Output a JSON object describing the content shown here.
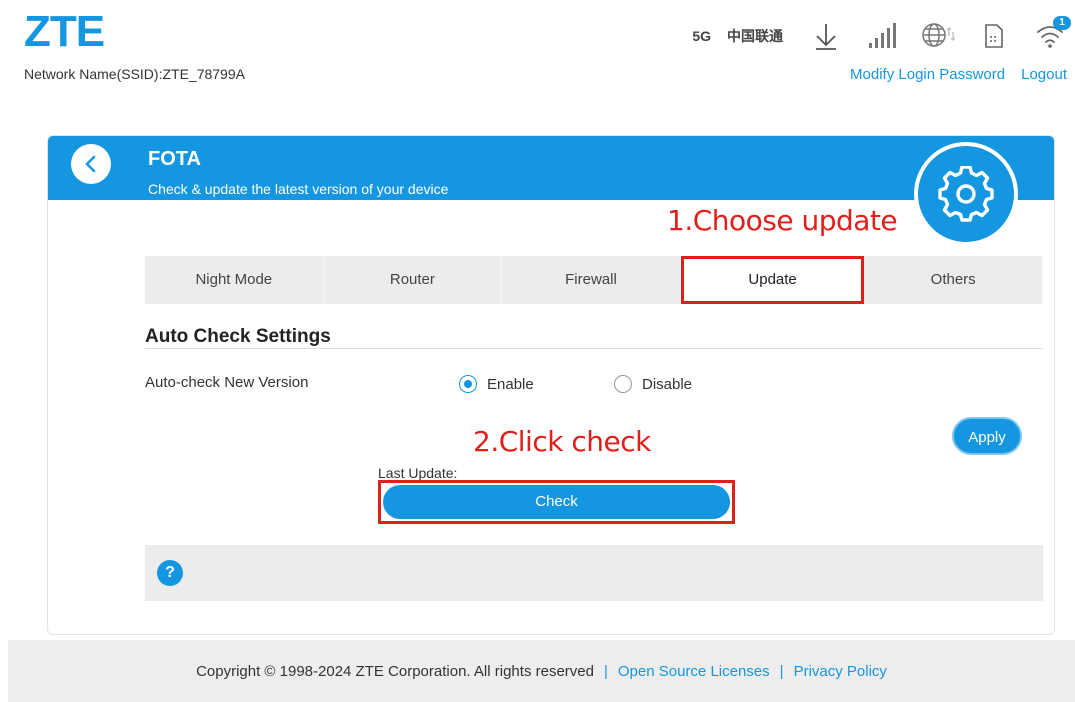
{
  "header": {
    "logo": "ZTE",
    "ssid_text": "Network Name(SSID):ZTE_78799A",
    "network_type": "5G",
    "carrier": "中国联通",
    "wifi_badge": "1",
    "links": {
      "modify_password": "Modify Login Password",
      "logout": "Logout"
    },
    "icons": [
      "download-icon",
      "signal-icon",
      "globe-icon",
      "sim-icon",
      "wifi-icon"
    ]
  },
  "banner": {
    "title": "FOTA",
    "subtitle": "Check & update the latest version of your device",
    "icons": [
      "back-arrow-icon",
      "gear-icon"
    ]
  },
  "annotations": {
    "step1": "1.Choose update",
    "step2": "2.Click check"
  },
  "tabs": [
    {
      "label": "Night Mode",
      "active": false
    },
    {
      "label": "Router",
      "active": false
    },
    {
      "label": "Firewall",
      "active": false
    },
    {
      "label": "Update",
      "active": true
    },
    {
      "label": "Others",
      "active": false
    }
  ],
  "auto_check": {
    "title": "Auto Check Settings",
    "label": "Auto-check New Version",
    "options": [
      {
        "label": "Enable",
        "selected": true
      },
      {
        "label": "Disable",
        "selected": false
      }
    ],
    "apply_label": "Apply"
  },
  "update": {
    "last_update_label": "Last Update:",
    "check_label": "Check"
  },
  "help": {
    "icon_text": "?"
  },
  "footer": {
    "copyright": "Copyright © 1998-2024 ZTE Corporation. All rights reserved",
    "separator": "|",
    "open_source": "Open Source Licenses",
    "privacy": "Privacy Policy"
  },
  "colors": {
    "accent": "#1497e0",
    "annotation": "#e0201b",
    "tab_bg": "#ececec"
  }
}
